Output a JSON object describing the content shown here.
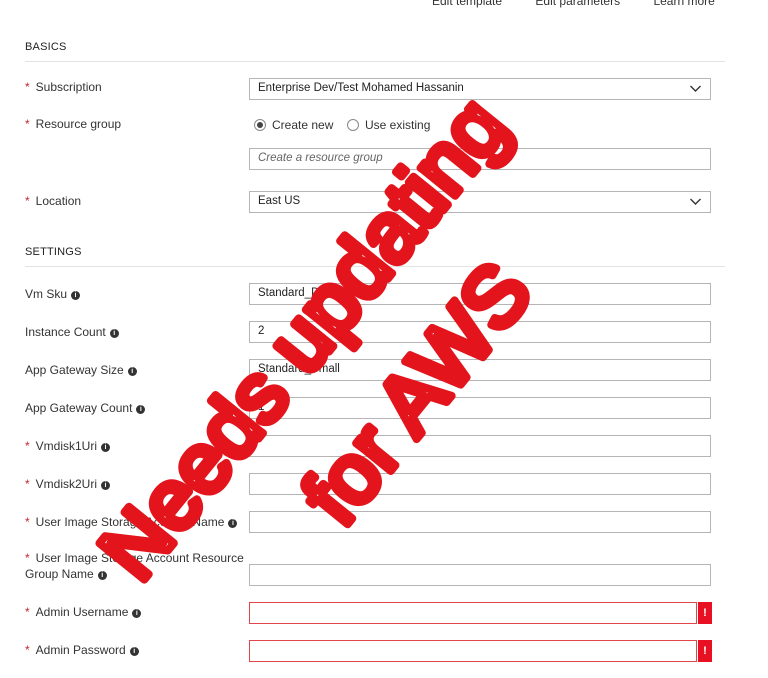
{
  "top_links": [
    "Edit template",
    "Edit parameters",
    "Learn more"
  ],
  "basics": {
    "heading": "BASICS",
    "subscription": {
      "label": "Subscription",
      "value": "Enterprise Dev/Test Mohamed Hassanin"
    },
    "resource_group": {
      "label": "Resource group",
      "create_new": "Create new",
      "use_existing": "Use existing",
      "selected": "Create new",
      "placeholder": "Create a resource group"
    },
    "location": {
      "label": "Location",
      "value": "East US"
    }
  },
  "settings": {
    "heading": "SETTINGS",
    "fields": [
      {
        "label": "Vm Sku",
        "required": false,
        "value": "Standard_D4s_v3"
      },
      {
        "label": "Instance Count",
        "required": false,
        "value": "2"
      },
      {
        "label": "App Gateway Size",
        "required": false,
        "value": "Standard_Small"
      },
      {
        "label": "App Gateway Count",
        "required": false,
        "value": "1"
      },
      {
        "label": "Vmdisk1Uri",
        "required": true,
        "value": ""
      },
      {
        "label": "Vmdisk2Uri",
        "required": true,
        "value": ""
      },
      {
        "label": "User Image Storage Account Name",
        "required": true,
        "value": ""
      },
      {
        "label": "User Image Storage Account Resource Group Name",
        "required": true,
        "value": ""
      },
      {
        "label": "Admin Username",
        "required": true,
        "value": "",
        "error": true
      },
      {
        "label": "Admin Password",
        "required": true,
        "value": "",
        "error": true
      }
    ]
  },
  "required_marker": "*",
  "info_icon_glyph": "i",
  "error_glyph": "!",
  "overlay": {
    "line1": "Needs updating",
    "line2": "for AWS",
    "color": "#e3141b"
  },
  "colors": {
    "required": "#c4262e",
    "error": "#e81123",
    "border": "#b5b5b5"
  },
  "icons": [
    "chevron-down-icon",
    "info-icon",
    "error-icon"
  ]
}
